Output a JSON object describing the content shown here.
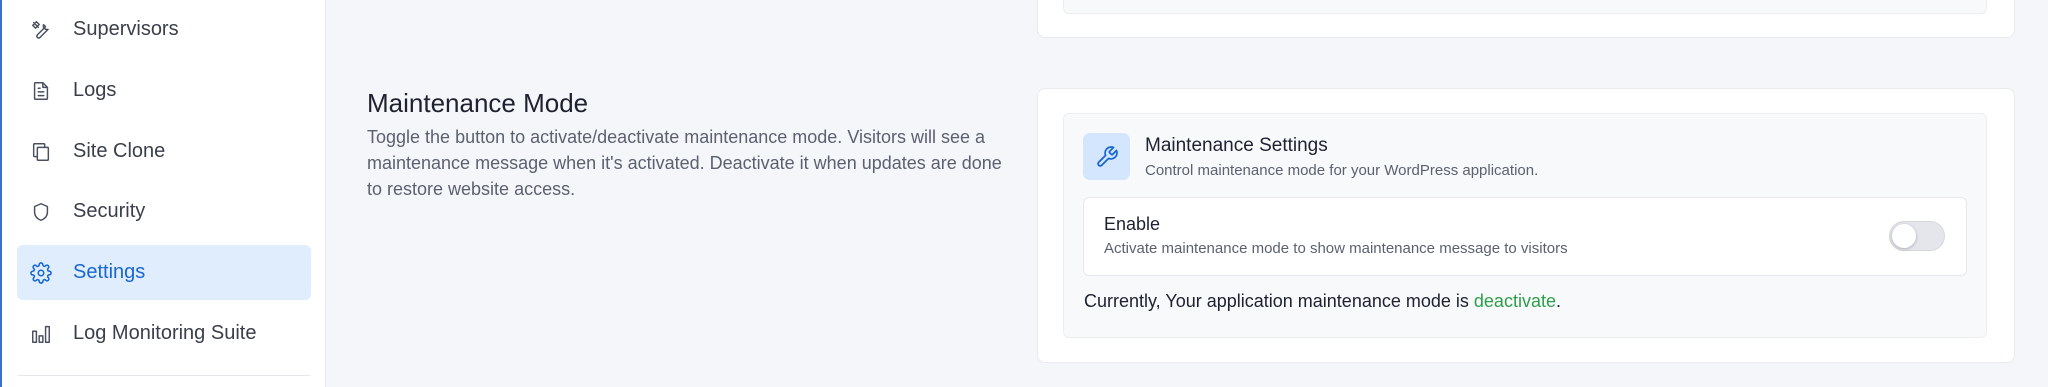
{
  "sidebar": {
    "items": [
      {
        "label": "Supervisors",
        "icon": "tools-icon",
        "active": false
      },
      {
        "label": "Logs",
        "icon": "document-icon",
        "active": false
      },
      {
        "label": "Site Clone",
        "icon": "copy-icon",
        "active": false
      },
      {
        "label": "Security",
        "icon": "shield-icon",
        "active": false
      },
      {
        "label": "Settings",
        "icon": "gear-icon",
        "active": true
      },
      {
        "label": "Log Monitoring Suite",
        "icon": "bar-chart-icon",
        "active": false
      }
    ]
  },
  "section": {
    "title": "Maintenance Mode",
    "description": "Toggle the button to activate/deactivate maintenance mode. Visitors will see a maintenance message when it's activated. Deactivate it when updates are done to restore website access."
  },
  "panel": {
    "icon": "wrench-icon",
    "title": "Maintenance Settings",
    "subtitle": "Control maintenance mode for your WordPress application.",
    "enable_label": "Enable",
    "enable_desc": "Activate maintenance mode to show maintenance message to visitors",
    "toggle_on": false,
    "status_prefix": "Currently, Your application maintenance mode is ",
    "status_value": "deactivate",
    "status_suffix": "."
  },
  "colors": {
    "accent": "#1967d2",
    "active_bg": "#e0edfc",
    "status_green": "#2e9e4a",
    "icon_bg": "#d3e6fd"
  }
}
